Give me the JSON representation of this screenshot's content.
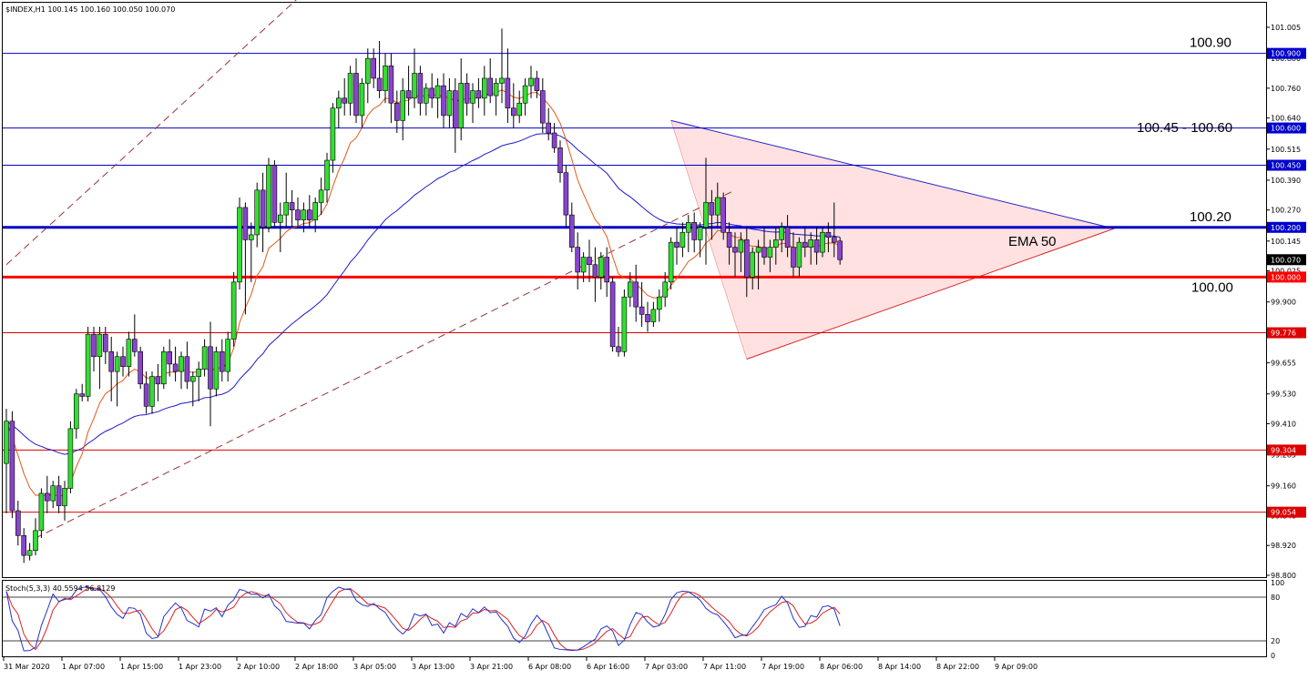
{
  "header": {
    "symbol_text": "$INDEX,H1  100.145 100.160 100.050 100.070"
  },
  "chart_data": {
    "type": "candlestick",
    "symbol": "$INDEX",
    "timeframe": "H1",
    "ohlc_last": {
      "open": 100.145,
      "high": 100.16,
      "low": 100.05,
      "close": 100.07
    },
    "ylim": [
      98.8,
      101.005
    ],
    "y_ticks": [
      {
        "value": 101.005,
        "label": "101.005"
      },
      {
        "value": 100.88,
        "label": "100.880"
      },
      {
        "value": 100.76,
        "label": "100.760"
      },
      {
        "value": 100.64,
        "label": "100.640"
      },
      {
        "value": 100.515,
        "label": "100.515"
      },
      {
        "value": 100.39,
        "label": "100.390"
      },
      {
        "value": 100.27,
        "label": "100.270"
      },
      {
        "value": 100.145,
        "label": "100.145"
      },
      {
        "value": 100.025,
        "label": "100.025"
      },
      {
        "value": 99.9,
        "label": "99.900"
      },
      {
        "value": 99.775,
        "label": "99.775"
      },
      {
        "value": 99.655,
        "label": "99.655"
      },
      {
        "value": 99.53,
        "label": "99.530"
      },
      {
        "value": 99.41,
        "label": "99.410"
      },
      {
        "value": 99.285,
        "label": "99.285"
      },
      {
        "value": 99.16,
        "label": "99.160"
      },
      {
        "value": 99.04,
        "label": "99.040"
      },
      {
        "value": 98.92,
        "label": "98.920"
      },
      {
        "value": 98.8,
        "label": "98.800"
      }
    ],
    "x_ticks": [
      "31 Mar 2020",
      "1 Apr 07:00",
      "1 Apr 15:00",
      "1 Apr 23:00",
      "2 Apr 10:00",
      "2 Apr 18:00",
      "3 Apr 05:00",
      "3 Apr 13:00",
      "3 Apr 21:00",
      "6 Apr 08:00",
      "6 Apr 16:00",
      "7 Apr 03:00",
      "7 Apr 11:00",
      "7 Apr 19:00",
      "8 Apr 06:00",
      "8 Apr 14:00",
      "8 Apr 22:00",
      "9 Apr 09:00"
    ],
    "horizontal_levels": [
      {
        "value": 100.9,
        "label": "100.900",
        "color": "#0000cc",
        "width": 1
      },
      {
        "value": 100.6,
        "label": "100.600",
        "color": "#0000cc",
        "width": 1
      },
      {
        "value": 100.45,
        "label": "100.450",
        "color": "#0000cc",
        "width": 1
      },
      {
        "value": 100.2,
        "label": "100.200",
        "color": "#0000cc",
        "width": 3
      },
      {
        "value": 100.0,
        "label": "100.000",
        "color": "#ff0000",
        "width": 3
      },
      {
        "value": 99.776,
        "label": "99.776",
        "color": "#dd0000",
        "width": 1
      },
      {
        "value": 99.304,
        "label": "99.304",
        "color": "#dd0000",
        "width": 1
      },
      {
        "value": 99.054,
        "label": "99.054",
        "color": "#dd0000",
        "width": 1
      }
    ],
    "current_price_label": "100.070",
    "annotations": [
      {
        "text": "100.90",
        "value": 100.9
      },
      {
        "text": "100.45 - 100.60",
        "value": 100.525
      },
      {
        "text": "100.20",
        "value": 100.2
      },
      {
        "text": "100.00",
        "value": 100.0
      },
      {
        "text": "EMA 50",
        "value": 100.145
      }
    ],
    "candles": [
      [
        99.25,
        99.47,
        99.05,
        99.42
      ],
      [
        99.42,
        99.46,
        99.03,
        99.06
      ],
      [
        99.06,
        99.1,
        98.92,
        98.96
      ],
      [
        98.96,
        98.99,
        98.85,
        98.88
      ],
      [
        98.88,
        98.93,
        98.86,
        98.9
      ],
      [
        98.9,
        99.03,
        98.88,
        98.98
      ],
      [
        98.98,
        99.15,
        98.95,
        99.13
      ],
      [
        99.13,
        99.2,
        99.05,
        99.1
      ],
      [
        99.1,
        99.18,
        99.07,
        99.16
      ],
      [
        99.16,
        99.2,
        99.05,
        99.08
      ],
      [
        99.08,
        99.18,
        99.02,
        99.15
      ],
      [
        99.15,
        99.42,
        99.13,
        99.39
      ],
      [
        99.39,
        99.55,
        99.35,
        99.53
      ],
      [
        99.53,
        99.57,
        99.5,
        99.52
      ],
      [
        99.52,
        99.8,
        99.5,
        99.77
      ],
      [
        99.77,
        99.8,
        99.62,
        99.68
      ],
      [
        99.68,
        99.8,
        99.55,
        99.77
      ],
      [
        99.77,
        99.8,
        99.65,
        99.7
      ],
      [
        99.7,
        99.76,
        99.5,
        99.62
      ],
      [
        99.62,
        99.7,
        99.48,
        99.68
      ],
      [
        99.68,
        99.72,
        99.6,
        99.64
      ],
      [
        99.64,
        99.78,
        99.6,
        99.75
      ],
      [
        99.75,
        99.85,
        99.68,
        99.7
      ],
      [
        99.7,
        99.72,
        99.55,
        99.57
      ],
      [
        99.57,
        99.62,
        99.45,
        99.48
      ],
      [
        99.48,
        99.62,
        99.45,
        99.6
      ],
      [
        99.6,
        99.65,
        99.5,
        99.57
      ],
      [
        99.57,
        99.72,
        99.55,
        99.7
      ],
      [
        99.7,
        99.75,
        99.6,
        99.65
      ],
      [
        99.65,
        99.72,
        99.58,
        99.62
      ],
      [
        99.62,
        99.7,
        99.55,
        99.68
      ],
      [
        99.68,
        99.74,
        99.55,
        99.58
      ],
      [
        99.58,
        99.62,
        99.48,
        99.6
      ],
      [
        99.6,
        99.66,
        99.5,
        99.63
      ],
      [
        99.63,
        99.75,
        99.6,
        99.72
      ],
      [
        99.72,
        99.82,
        99.4,
        99.55
      ],
      [
        99.55,
        99.72,
        99.52,
        99.7
      ],
      [
        99.7,
        99.75,
        99.58,
        99.62
      ],
      [
        99.62,
        99.78,
        99.58,
        99.75
      ],
      [
        99.75,
        100.02,
        99.72,
        99.98
      ],
      [
        99.98,
        100.32,
        99.95,
        100.28
      ],
      [
        100.28,
        100.3,
        99.85,
        100.15
      ],
      [
        100.15,
        100.22,
        99.98,
        100.17
      ],
      [
        100.17,
        100.38,
        100.12,
        100.35
      ],
      [
        100.35,
        100.42,
        100.1,
        100.2
      ],
      [
        100.2,
        100.48,
        100.18,
        100.45
      ],
      [
        100.45,
        100.47,
        100.2,
        100.22
      ],
      [
        100.22,
        100.3,
        100.1,
        100.25
      ],
      [
        100.25,
        100.42,
        100.2,
        100.3
      ],
      [
        100.3,
        100.35,
        100.2,
        100.27
      ],
      [
        100.27,
        100.32,
        100.2,
        100.23
      ],
      [
        100.23,
        100.3,
        100.18,
        100.27
      ],
      [
        100.27,
        100.33,
        100.2,
        100.23
      ],
      [
        100.23,
        100.32,
        100.18,
        100.3
      ],
      [
        100.3,
        100.4,
        100.25,
        100.35
      ],
      [
        100.35,
        100.5,
        100.3,
        100.47
      ],
      [
        100.47,
        100.7,
        100.42,
        100.68
      ],
      [
        100.68,
        100.75,
        100.6,
        100.72
      ],
      [
        100.72,
        100.8,
        100.65,
        100.7
      ],
      [
        100.7,
        100.85,
        100.65,
        100.82
      ],
      [
        100.82,
        100.88,
        100.62,
        100.65
      ],
      [
        100.65,
        100.8,
        100.6,
        100.78
      ],
      [
        100.78,
        100.92,
        100.7,
        100.88
      ],
      [
        100.88,
        100.92,
        100.76,
        100.8
      ],
      [
        100.8,
        100.95,
        100.72,
        100.75
      ],
      [
        100.75,
        100.9,
        100.7,
        100.85
      ],
      [
        100.85,
        100.9,
        100.62,
        100.7
      ],
      [
        100.7,
        100.75,
        100.58,
        100.63
      ],
      [
        100.63,
        100.8,
        100.55,
        100.75
      ],
      [
        100.75,
        100.85,
        100.65,
        100.72
      ],
      [
        100.72,
        100.92,
        100.68,
        100.82
      ],
      [
        100.82,
        100.85,
        100.65,
        100.7
      ],
      [
        100.7,
        100.78,
        100.65,
        100.76
      ],
      [
        100.76,
        100.82,
        100.68,
        100.72
      ],
      [
        100.72,
        100.8,
        100.64,
        100.77
      ],
      [
        100.77,
        100.82,
        100.6,
        100.65
      ],
      [
        100.65,
        100.8,
        100.6,
        100.75
      ],
      [
        100.75,
        100.8,
        100.5,
        100.6
      ],
      [
        100.6,
        100.88,
        100.55,
        100.78
      ],
      [
        100.78,
        100.82,
        100.65,
        100.7
      ],
      [
        100.7,
        100.78,
        100.62,
        100.75
      ],
      [
        100.75,
        100.8,
        100.68,
        100.72
      ],
      [
        100.72,
        100.85,
        100.65,
        100.8
      ],
      [
        100.8,
        100.88,
        100.7,
        100.73
      ],
      [
        100.73,
        100.8,
        100.65,
        100.78
      ],
      [
        100.78,
        101.0,
        100.7,
        100.8
      ],
      [
        100.8,
        100.92,
        100.62,
        100.68
      ],
      [
        100.68,
        100.78,
        100.6,
        100.65
      ],
      [
        100.65,
        100.75,
        100.62,
        100.7
      ],
      [
        100.7,
        100.8,
        100.65,
        100.77
      ],
      [
        100.77,
        100.85,
        100.72,
        100.8
      ],
      [
        100.8,
        100.83,
        100.72,
        100.75
      ],
      [
        100.75,
        100.8,
        100.58,
        100.62
      ],
      [
        100.62,
        100.68,
        100.55,
        100.58
      ],
      [
        100.58,
        100.62,
        100.5,
        100.52
      ],
      [
        100.52,
        100.55,
        100.38,
        100.42
      ],
      [
        100.42,
        100.45,
        100.2,
        100.25
      ],
      [
        100.25,
        100.3,
        100.1,
        100.12
      ],
      [
        100.12,
        100.18,
        99.95,
        100.02
      ],
      [
        100.02,
        100.1,
        99.98,
        100.08
      ],
      [
        100.08,
        100.15,
        99.98,
        100.05
      ],
      [
        100.05,
        100.12,
        99.9,
        100.0
      ],
      [
        100.0,
        100.1,
        99.95,
        100.08
      ],
      [
        100.08,
        100.12,
        99.92,
        99.98
      ],
      [
        99.98,
        100.0,
        99.7,
        99.72
      ],
      [
        99.72,
        99.8,
        99.68,
        99.7
      ],
      [
        99.7,
        99.95,
        99.68,
        99.92
      ],
      [
        99.92,
        100.02,
        99.88,
        99.98
      ],
      [
        99.98,
        100.05,
        99.82,
        99.88
      ],
      [
        99.88,
        99.98,
        99.8,
        99.85
      ],
      [
        99.85,
        99.9,
        99.78,
        99.82
      ],
      [
        99.82,
        99.9,
        99.8,
        99.87
      ],
      [
        99.87,
        99.95,
        99.82,
        99.92
      ],
      [
        99.92,
        100.02,
        99.88,
        99.98
      ],
      [
        99.98,
        100.16,
        99.95,
        100.14
      ],
      [
        100.14,
        100.2,
        100.05,
        100.12
      ],
      [
        100.12,
        100.22,
        100.08,
        100.18
      ],
      [
        100.18,
        100.25,
        100.1,
        100.22
      ],
      [
        100.22,
        100.26,
        100.1,
        100.15
      ],
      [
        100.15,
        100.22,
        100.08,
        100.2
      ],
      [
        100.2,
        100.48,
        100.05,
        100.3
      ],
      [
        100.3,
        100.35,
        100.15,
        100.25
      ],
      [
        100.25,
        100.38,
        100.2,
        100.32
      ],
      [
        100.32,
        100.34,
        100.15,
        100.18
      ],
      [
        100.18,
        100.22,
        100.05,
        100.12
      ],
      [
        100.12,
        100.18,
        100.0,
        100.1
      ],
      [
        100.1,
        100.18,
        100.02,
        100.15
      ],
      [
        100.15,
        100.2,
        99.92,
        100.0
      ],
      [
        100.0,
        100.12,
        99.95,
        100.1
      ],
      [
        100.1,
        100.15,
        99.95,
        100.12
      ],
      [
        100.12,
        100.2,
        100.05,
        100.08
      ],
      [
        100.08,
        100.15,
        100.02,
        100.12
      ],
      [
        100.12,
        100.2,
        100.05,
        100.15
      ],
      [
        100.15,
        100.22,
        100.1,
        100.2
      ],
      [
        100.2,
        100.25,
        100.08,
        100.12
      ],
      [
        100.12,
        100.18,
        100.0,
        100.04
      ],
      [
        100.04,
        100.16,
        100.0,
        100.14
      ],
      [
        100.14,
        100.2,
        100.08,
        100.12
      ],
      [
        100.12,
        100.18,
        100.05,
        100.15
      ],
      [
        100.15,
        100.2,
        100.05,
        100.1
      ],
      [
        100.1,
        100.2,
        100.08,
        100.18
      ],
      [
        100.18,
        100.22,
        100.1,
        100.16
      ],
      [
        100.16,
        100.3,
        100.08,
        100.14
      ],
      [
        100.145,
        100.16,
        100.05,
        100.07
      ]
    ],
    "stochastic": {
      "label": "Stoch(5,3,3) 40.5594 56.8129",
      "main": 40.5594,
      "signal": 56.8129,
      "ylim": [
        0,
        100
      ],
      "levels": [
        {
          "value": 100,
          "label": "100"
        },
        {
          "value": 80,
          "label": "80"
        },
        {
          "value": 20,
          "label": "20"
        },
        {
          "value": 0,
          "label": "0"
        }
      ]
    }
  }
}
